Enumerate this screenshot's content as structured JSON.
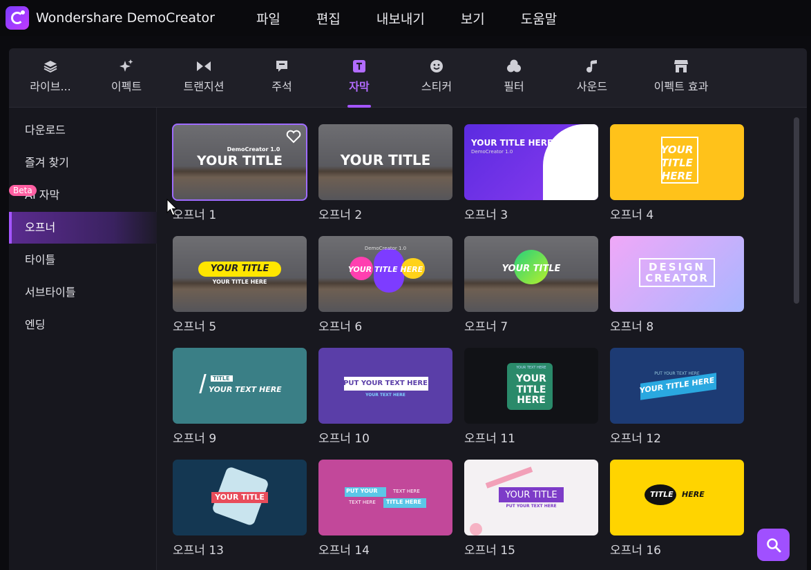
{
  "app": {
    "title": "Wondershare DemoCreator"
  },
  "menu": [
    "파일",
    "편집",
    "내보내기",
    "보기",
    "도움말"
  ],
  "tabs": [
    {
      "label": "라이브...",
      "icon": "layers-icon"
    },
    {
      "label": "이펙트",
      "icon": "sparkle-icon"
    },
    {
      "label": "트랜지션",
      "icon": "transition-icon"
    },
    {
      "label": "주석",
      "icon": "annotation-icon"
    },
    {
      "label": "자막",
      "icon": "caption-icon"
    },
    {
      "label": "스티커",
      "icon": "smiley-icon"
    },
    {
      "label": "필터",
      "icon": "filter-icon"
    },
    {
      "label": "사운드",
      "icon": "music-note-icon"
    },
    {
      "label": "이펙트 효과",
      "icon": "store-icon"
    }
  ],
  "sidebar": {
    "beta_badge": "Beta",
    "items": [
      "다운로드",
      "즐겨 찾기",
      "AI 자막",
      "오프너",
      "타이틀",
      "서브타이틀",
      "엔딩"
    ]
  },
  "cards": [
    {
      "caption": "오프너 1",
      "lines": [
        "DemoCreator 1.0",
        "YOUR TITLE"
      ]
    },
    {
      "caption": "오프너 2",
      "lines": [
        "YOUR TITLE"
      ]
    },
    {
      "caption": "오프너 3",
      "lines": [
        "YOUR TITLE HERE",
        "DemoCreator 1.0"
      ]
    },
    {
      "caption": "오프너 4",
      "lines": [
        "YOUR",
        "TITLE",
        "HERE"
      ]
    },
    {
      "caption": "오프너 5",
      "lines": [
        "YOUR TITLE",
        "YOUR TITLE HERE"
      ]
    },
    {
      "caption": "오프너 6",
      "lines": [
        "YOUR TITLE HERE",
        "DemoCreator 1.0"
      ]
    },
    {
      "caption": "오프너 7",
      "lines": [
        "YOUR TITLE"
      ]
    },
    {
      "caption": "오프너 8",
      "lines": [
        "DESIGN",
        "CREATOR"
      ]
    },
    {
      "caption": "오프너 9",
      "lines": [
        "TITLE",
        "YOUR TEXT HERE"
      ]
    },
    {
      "caption": "오프너 10",
      "lines": [
        "PUT YOUR TEXT HERE",
        "YOUR TEXT HERE"
      ]
    },
    {
      "caption": "오프너 11",
      "lines": [
        "YOUR TEXT HERE",
        "YOUR",
        "TITLE",
        "HERE"
      ]
    },
    {
      "caption": "오프너 12",
      "lines": [
        "PUT YOUR TEXT HERE",
        "YOUR TITLE HERE"
      ]
    },
    {
      "caption": "오프너 13",
      "lines": [
        "YOUR TITLE"
      ]
    },
    {
      "caption": "오프너 14",
      "lines": [
        "PUT YOUR",
        "TEXT HERE",
        "TEXT HERE",
        "TITLE HERE"
      ]
    },
    {
      "caption": "오프너 15",
      "lines": [
        "YOUR TITLE",
        "PUT YOUR TEXT HERE"
      ]
    },
    {
      "caption": "오프너 16",
      "lines": [
        "TITLE",
        "HERE"
      ]
    }
  ],
  "colors": {
    "accent": "#a455ff",
    "panel": "#18181f",
    "search_button": "#a050ff"
  }
}
